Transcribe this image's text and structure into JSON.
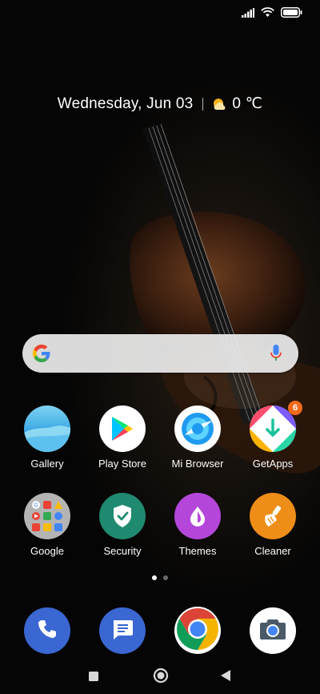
{
  "date_widget": {
    "date": "Wednesday, Jun 03",
    "temperature": "0 ℃",
    "weather_icon": "partly-sunny-icon"
  },
  "search": {
    "logo": "google-g-icon",
    "voice_icon": "microphone-icon"
  },
  "apps": [
    {
      "label": "Gallery",
      "icon": "gallery-icon"
    },
    {
      "label": "Play Store",
      "icon": "play-store-icon"
    },
    {
      "label": "Mi Browser",
      "icon": "mi-browser-icon"
    },
    {
      "label": "GetApps",
      "icon": "getapps-icon",
      "badge": "6"
    },
    {
      "label": "Google",
      "icon": "google-folder-icon"
    },
    {
      "label": "Security",
      "icon": "security-shield-icon"
    },
    {
      "label": "Themes",
      "icon": "themes-icon"
    },
    {
      "label": "Cleaner",
      "icon": "cleaner-brush-icon"
    }
  ],
  "pages": {
    "count": 2,
    "current": 1
  },
  "dock": [
    {
      "icon": "phone-icon"
    },
    {
      "icon": "messages-icon"
    },
    {
      "icon": "chrome-icon"
    },
    {
      "icon": "camera-icon"
    }
  ],
  "nav": [
    "recents-square-icon",
    "home-circle-icon",
    "back-triangle-icon"
  ],
  "colors": {
    "badge": "#f26a1b",
    "security": "#1f8a70",
    "themes": "#b447d9",
    "cleaner": "#ef8d19",
    "phone": "#3a67d1",
    "messages": "#3a67d1"
  }
}
